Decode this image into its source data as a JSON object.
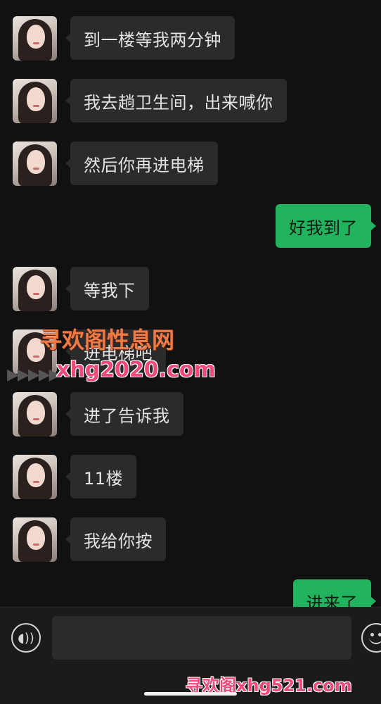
{
  "messages": [
    {
      "side": "in",
      "text": "到一楼等我两分钟"
    },
    {
      "side": "in",
      "text": "我去趟卫生间，出来喊你"
    },
    {
      "side": "in",
      "text": "然后你再进电梯"
    },
    {
      "side": "out",
      "text": "好我到了"
    },
    {
      "side": "in",
      "text": "等我下"
    },
    {
      "side": "in",
      "text": "进电梯吧"
    },
    {
      "side": "in",
      "text": "进了告诉我"
    },
    {
      "side": "in",
      "text": "11楼"
    },
    {
      "side": "in",
      "text": "我给你按"
    },
    {
      "side": "out",
      "text": "进来了"
    }
  ],
  "watermark": {
    "line1": "寻欢阁性息网",
    "line2": "xhg2020.com",
    "bottom": "寻欢阁xhg521.com"
  },
  "input_bar": {
    "voice_icon": "voice-icon",
    "emoji_icon": "emoji-icon",
    "input_value": ""
  },
  "colors": {
    "background": "#111111",
    "incoming_bubble": "#2b2b2b",
    "outgoing_bubble": "#22b35e"
  }
}
